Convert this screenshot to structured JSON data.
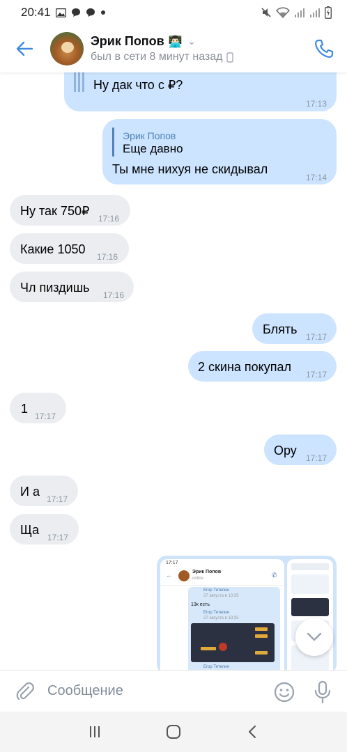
{
  "status_bar": {
    "time": "20:41",
    "left_icons": [
      "image-icon",
      "chat-bubble-icon",
      "chat-bubble-icon",
      "dot-icon"
    ],
    "right_icons": [
      "mute-icon",
      "wifi-icon",
      "signal-icon",
      "signal-icon",
      "battery-icon"
    ]
  },
  "header": {
    "name": "Эрик Попов",
    "name_emoji": "👨🏻‍💻",
    "status": "был в сети 8 минут назад",
    "accent": "#3f8ae0"
  },
  "messages": [
    {
      "id": "m1",
      "dir": "out",
      "text": "Ну дак что с ₽?",
      "time": "17:13"
    },
    {
      "id": "m2",
      "dir": "out",
      "reply_name": "Эрик Попов",
      "reply_text": "Еще давно",
      "text": "Ты мне нихуя не скидывал",
      "time": "17:14"
    },
    {
      "id": "m3",
      "dir": "in",
      "text": "Ну так 750₽",
      "time": "17:16"
    },
    {
      "id": "m4",
      "dir": "in",
      "text": "Какие 1050",
      "time": "17:16"
    },
    {
      "id": "m5",
      "dir": "in",
      "text": "Чл пиздишь",
      "time": "17:16"
    },
    {
      "id": "m6",
      "dir": "out",
      "text": "Блять",
      "time": "17:17"
    },
    {
      "id": "m7",
      "dir": "out",
      "text": "2 скина покупал",
      "time": "17:17"
    },
    {
      "id": "m8",
      "dir": "in",
      "text": "1",
      "time": "17:17"
    },
    {
      "id": "m9",
      "dir": "out",
      "text": "Ору",
      "time": "17:17"
    },
    {
      "id": "m10",
      "dir": "in",
      "text": "И а",
      "time": "17:17"
    },
    {
      "id": "m11",
      "dir": "in",
      "text": "Ща",
      "time": "17:17"
    }
  ],
  "attachment": {
    "mini_time": "17:17",
    "mini_name": "Эрик Попов",
    "mini_status": "online",
    "mini_sender1": "Егор Тетелин",
    "mini_date1": "27 августа в 13:35",
    "mini_text": "13к есть",
    "mini_sender2": "Егор Тетелин",
    "mini_date2": "27 августа в 13:35",
    "mini_sender3": "Егор Тетелин"
  },
  "composer": {
    "placeholder": "Сообщение"
  },
  "colors": {
    "outgoing_bubble": "#cce4ff",
    "incoming_bubble": "#ebedf0",
    "accent": "#3f8ae0",
    "time_text": "#8c97a3"
  }
}
